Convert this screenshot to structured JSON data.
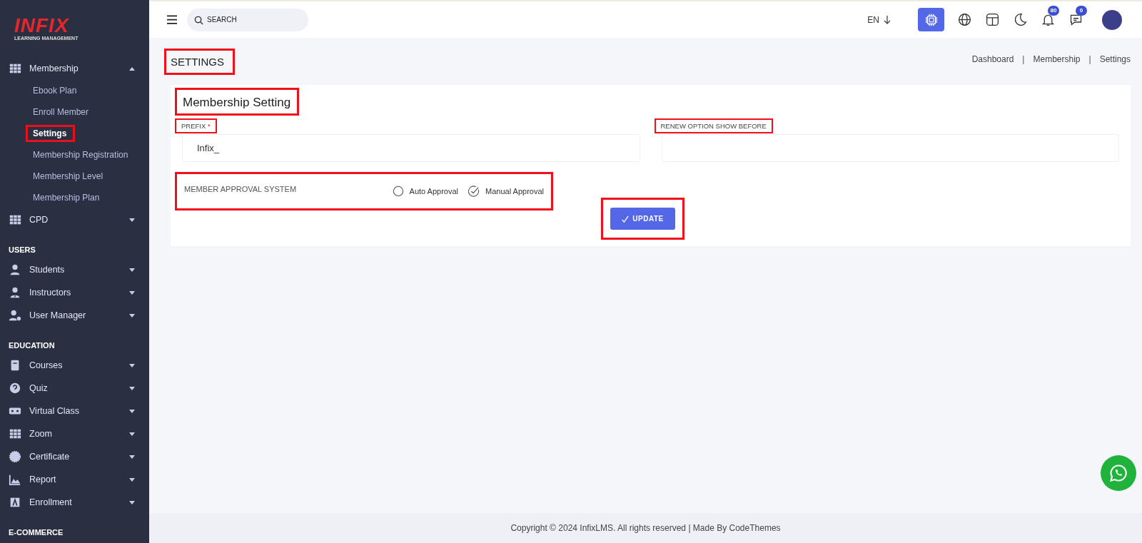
{
  "logo": {
    "name": "INFIX",
    "tagline": "LEARNING MANAGEMENT"
  },
  "sidebar": {
    "sections": [
      {
        "items": [
          {
            "label": "Membership",
            "expanded": true,
            "children": [
              {
                "label": "Ebook Plan",
                "selected": false
              },
              {
                "label": "Enroll Member",
                "selected": false
              },
              {
                "label": "Settings",
                "selected": true
              },
              {
                "label": "Membership Registration",
                "selected": false
              },
              {
                "label": "Membership Level",
                "selected": false
              },
              {
                "label": "Membership Plan",
                "selected": false
              }
            ]
          },
          {
            "label": "CPD",
            "expanded": false
          }
        ]
      },
      {
        "heading": "USERS",
        "items": [
          {
            "label": "Students",
            "expanded": false
          },
          {
            "label": "Instructors",
            "expanded": false
          },
          {
            "label": "User Manager",
            "expanded": false
          }
        ]
      },
      {
        "heading": "EDUCATION",
        "items": [
          {
            "label": "Courses",
            "expanded": false
          },
          {
            "label": "Quiz",
            "expanded": false
          },
          {
            "label": "Virtual Class",
            "expanded": false
          },
          {
            "label": "Zoom",
            "expanded": false
          },
          {
            "label": "Certificate",
            "expanded": false
          },
          {
            "label": "Report",
            "expanded": false
          },
          {
            "label": "Enrollment",
            "expanded": false
          }
        ]
      },
      {
        "heading": "E-COMMERCE"
      }
    ]
  },
  "header": {
    "search": {
      "placeholder": "SEARCH"
    },
    "language": "EN",
    "notifications": "80",
    "messages": "0"
  },
  "page": {
    "title": "SETTINGS",
    "breadcrumbs": [
      "Dashboard",
      "Membership",
      "Settings"
    ],
    "breadcrumb_separator": "|"
  },
  "card": {
    "title": "Membership Setting",
    "fields": [
      {
        "label": "PREFIX",
        "required_mark": "*",
        "value": "Infix_"
      },
      {
        "label": "RENEW OPTION SHOW BEFORE"
      }
    ],
    "approval": {
      "label": "MEMBER APPROVAL SYSTEM",
      "options": [
        {
          "label": "Auto Approval",
          "selected": false
        },
        {
          "label": "Manual Approval",
          "selected": true
        }
      ]
    },
    "button": "UPDATE"
  },
  "footer": "Copyright © 2024 InfixLMS. All rights reserved | Made By CodeThemes"
}
